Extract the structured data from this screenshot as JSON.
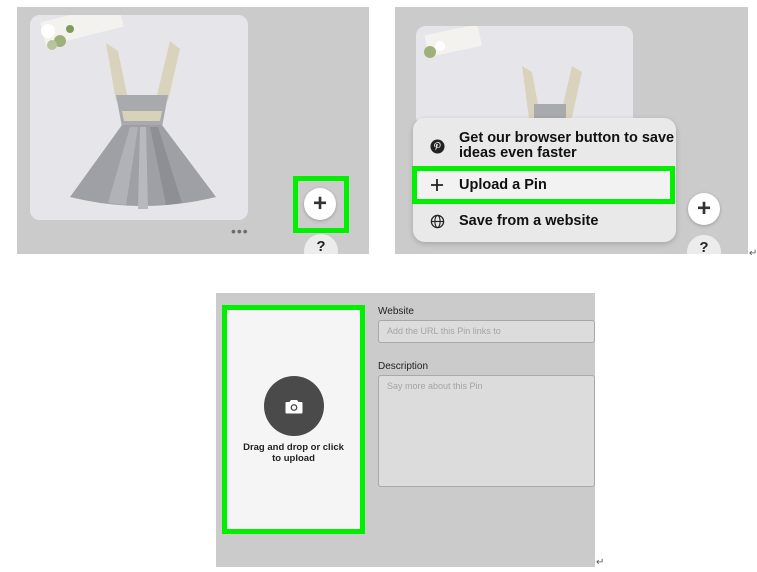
{
  "panel1": {
    "more_label": "•••",
    "add_label": "+",
    "help_label": "?"
  },
  "panel2": {
    "add_label": "+",
    "help_label": "?",
    "menu": [
      {
        "icon": "pinterest-icon",
        "label": "Get our browser button to save ideas even faster"
      },
      {
        "icon": "plus-icon",
        "label": "Upload a Pin"
      },
      {
        "icon": "globe-icon",
        "label": "Save from a website"
      }
    ]
  },
  "panel3": {
    "upload_text": "Drag and drop or click to upload",
    "website_label": "Website",
    "website_placeholder": "Add the URL this Pin links to",
    "description_label": "Description",
    "description_placeholder": "Say more about this Pin"
  },
  "colors": {
    "highlight": "#00f000",
    "panel_bg": "#cbcbcb"
  },
  "return_mark": "↵"
}
